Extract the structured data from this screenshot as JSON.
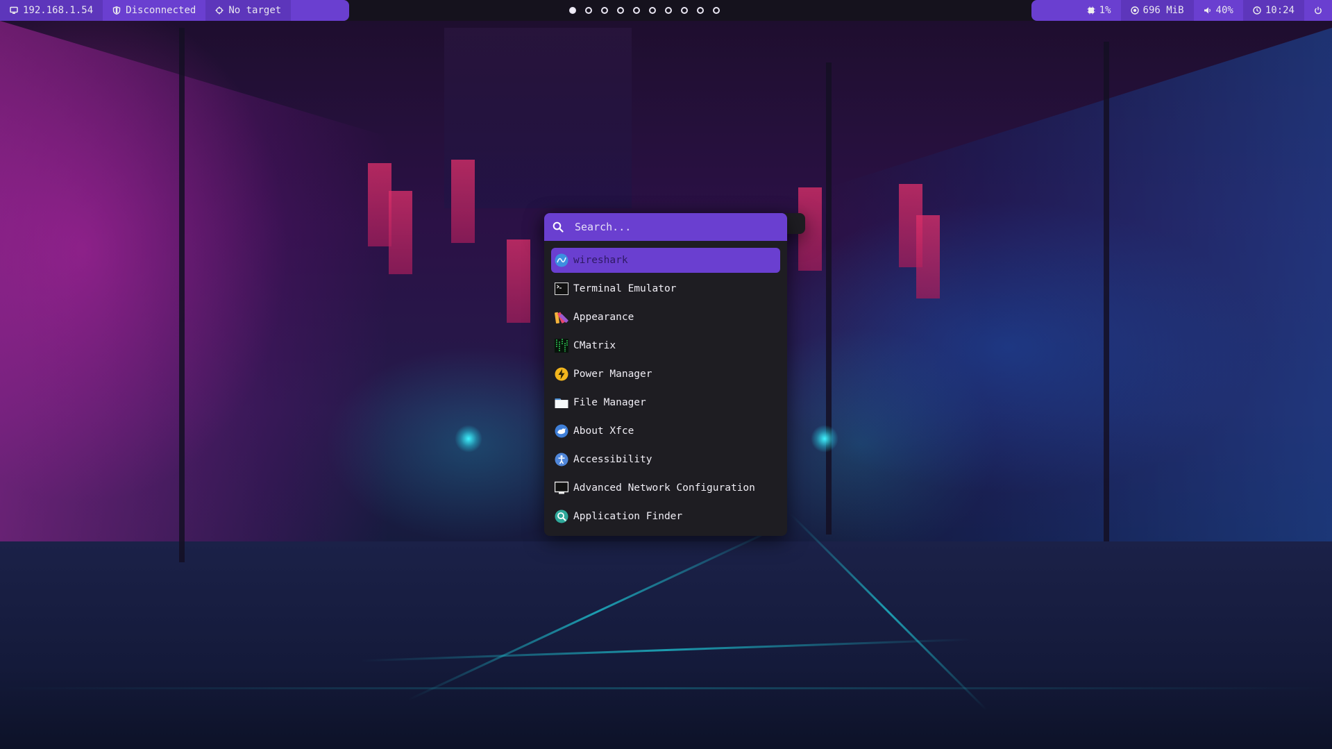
{
  "topbar": {
    "launcher_icon": "app-grid-icon",
    "ip_address": "192.168.1.54",
    "vpn_status": "Disconnected",
    "target": "No target",
    "workspaces": [
      {
        "index": 1,
        "active": true
      },
      {
        "index": 2,
        "active": false
      },
      {
        "index": 3,
        "active": false
      },
      {
        "index": 4,
        "active": false
      },
      {
        "index": 5,
        "active": false
      },
      {
        "index": 6,
        "active": false
      },
      {
        "index": 7,
        "active": false
      },
      {
        "index": 8,
        "active": false
      },
      {
        "index": 9,
        "active": false
      },
      {
        "index": 10,
        "active": false
      }
    ],
    "cpu": "1%",
    "memory": "696 MiB",
    "volume": "40%",
    "clock": "10:24",
    "power_icon": "power-icon"
  },
  "launcher": {
    "search": {
      "placeholder": "Search...",
      "value": ""
    },
    "selected_index": 0,
    "items": [
      {
        "label": "wireshark",
        "icon": "wireshark-icon"
      },
      {
        "label": "Terminal Emulator",
        "icon": "terminal-icon"
      },
      {
        "label": "Appearance",
        "icon": "appearance-icon"
      },
      {
        "label": "CMatrix",
        "icon": "cmatrix-icon"
      },
      {
        "label": "Power Manager",
        "icon": "power-manager-icon"
      },
      {
        "label": "File Manager",
        "icon": "file-manager-icon"
      },
      {
        "label": "About Xfce",
        "icon": "xfce-icon"
      },
      {
        "label": "Accessibility",
        "icon": "accessibility-icon"
      },
      {
        "label": "Advanced Network Configuration",
        "icon": "network-config-icon"
      },
      {
        "label": "Application Finder",
        "icon": "application-finder-icon"
      }
    ]
  },
  "colors": {
    "accent": "#6a3fd0",
    "bar_background": "#15121d",
    "launcher_background": "#1e1d22"
  }
}
